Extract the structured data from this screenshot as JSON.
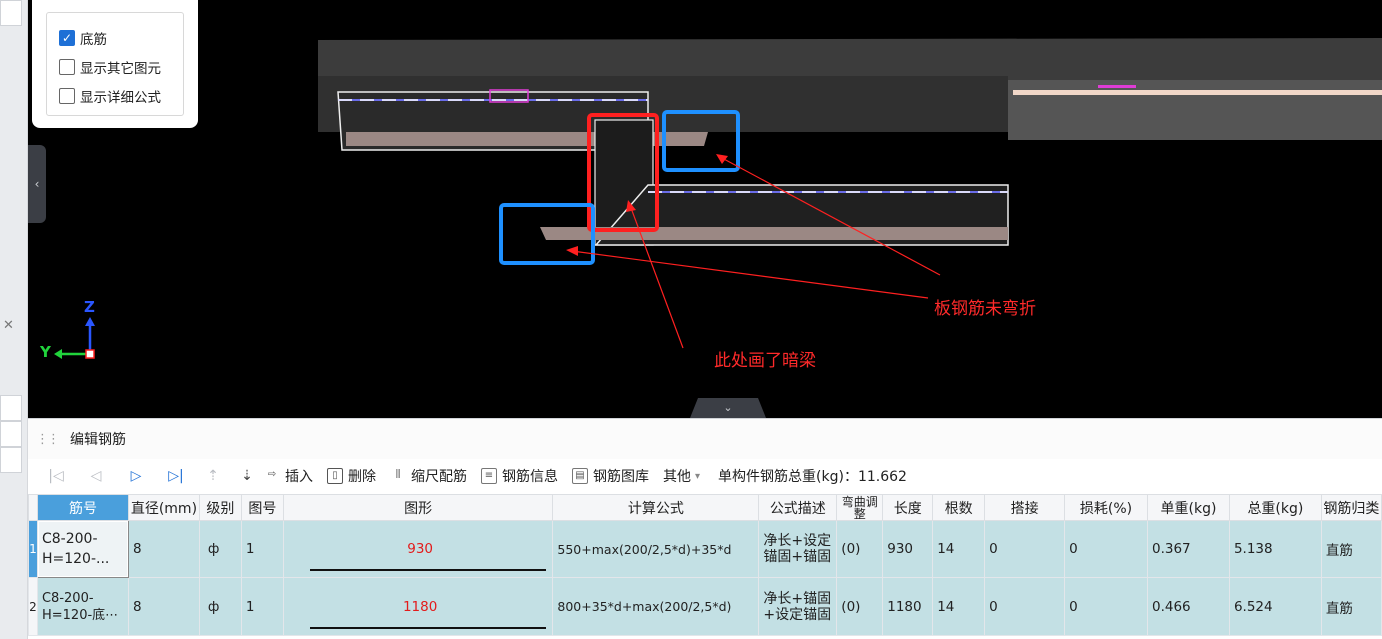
{
  "options": {
    "items": [
      {
        "label": "底筋",
        "checked": true
      },
      {
        "label": "显示其它图元",
        "checked": false
      },
      {
        "label": "显示详细公式",
        "checked": false
      }
    ]
  },
  "viewport": {
    "annotations": {
      "no_bend": "板钢筋未弯折",
      "hidden_beam": "此处画了暗梁"
    },
    "axes": {
      "y": "Y",
      "z": "Z"
    },
    "colors": {
      "red_box": "#ff2020",
      "blue_box": "#1e90ff",
      "annotation": "#ff2a2a"
    }
  },
  "editor": {
    "title": "编辑钢筋",
    "toolbar": {
      "insert": "插入",
      "delete": "删除",
      "scale": "缩尺配筋",
      "info": "钢筋信息",
      "library": "钢筋图库",
      "other": "其他",
      "total_label": "单构件钢筋总重(kg)：11.662"
    },
    "columns": [
      "筋号",
      "直径(mm)",
      "级别",
      "图号",
      "图形",
      "计算公式",
      "公式描述",
      "弯曲调整",
      "长度",
      "根数",
      "搭接",
      "损耗(%)",
      "单重(kg)",
      "总重(kg)",
      "钢筋归类"
    ],
    "rows": [
      {
        "idx": "1",
        "code": "C8-200-H=120-...",
        "dia": "8",
        "grade": "ф",
        "fig": "1",
        "shape": "930",
        "formula": "550+max(200/2,5*d)+35*d",
        "desc": "净长+设定锚固+锚固",
        "bend": "(0)",
        "length": "930",
        "count": "14",
        "lap": "0",
        "loss": "0",
        "unit_w": "0.367",
        "total_w": "5.138",
        "type": "直筋"
      },
      {
        "idx": "2",
        "code": "C8-200-H=120-底⋯",
        "dia": "8",
        "grade": "ф",
        "fig": "1",
        "shape": "1180",
        "formula": "800+35*d+max(200/2,5*d)",
        "desc": "净长+锚固+设定锚固",
        "bend": "(0)",
        "length": "1180",
        "count": "14",
        "lap": "0",
        "loss": "0",
        "unit_w": "0.466",
        "total_w": "6.524",
        "type": "直筋"
      }
    ]
  }
}
